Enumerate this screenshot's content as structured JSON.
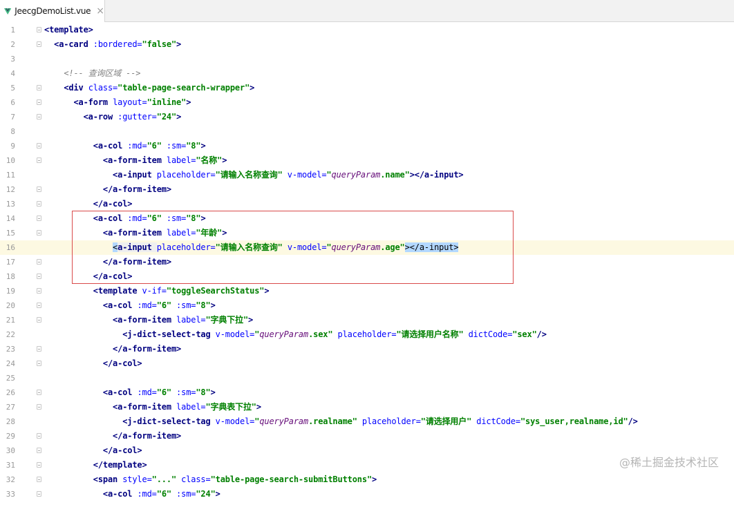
{
  "tab": {
    "filename": "JeecgDemoList.vue",
    "close_icon": "×"
  },
  "watermark": "@稀土掘金技术社区",
  "lines": [
    {
      "n": "1",
      "fold": true,
      "segs": [
        [
          "t",
          "<template>"
        ]
      ]
    },
    {
      "n": "2",
      "fold": true,
      "segs": [
        [
          "p",
          "  "
        ],
        [
          "t",
          "<a-card "
        ],
        [
          "a",
          ":bordered="
        ],
        [
          "v",
          "\"false\""
        ],
        [
          "t",
          ">"
        ]
      ]
    },
    {
      "n": "3",
      "segs": []
    },
    {
      "n": "4",
      "segs": [
        [
          "p",
          "    "
        ],
        [
          "c",
          "<!-- 查询区域 -->"
        ]
      ]
    },
    {
      "n": "5",
      "fold": true,
      "segs": [
        [
          "p",
          "    "
        ],
        [
          "t",
          "<div "
        ],
        [
          "a",
          "class="
        ],
        [
          "v",
          "\"table-page-search-wrapper\""
        ],
        [
          "t",
          ">"
        ]
      ]
    },
    {
      "n": "6",
      "fold": true,
      "segs": [
        [
          "p",
          "      "
        ],
        [
          "t",
          "<a-form "
        ],
        [
          "a",
          "layout="
        ],
        [
          "v",
          "\"inline\""
        ],
        [
          "t",
          ">"
        ]
      ]
    },
    {
      "n": "7",
      "fold": true,
      "segs": [
        [
          "p",
          "        "
        ],
        [
          "t",
          "<a-row "
        ],
        [
          "a",
          ":gutter="
        ],
        [
          "v",
          "\"24\""
        ],
        [
          "t",
          ">"
        ]
      ]
    },
    {
      "n": "8",
      "segs": []
    },
    {
      "n": "9",
      "fold": true,
      "segs": [
        [
          "p",
          "          "
        ],
        [
          "t",
          "<a-col "
        ],
        [
          "a",
          ":md="
        ],
        [
          "v",
          "\"6\""
        ],
        [
          "a",
          " :sm="
        ],
        [
          "v",
          "\"8\""
        ],
        [
          "t",
          ">"
        ]
      ]
    },
    {
      "n": "10",
      "fold": true,
      "segs": [
        [
          "p",
          "            "
        ],
        [
          "t",
          "<a-form-item "
        ],
        [
          "a",
          "label="
        ],
        [
          "v",
          "\"名称\""
        ],
        [
          "t",
          ">"
        ]
      ]
    },
    {
      "n": "11",
      "segs": [
        [
          "p",
          "              "
        ],
        [
          "t",
          "<a-input "
        ],
        [
          "a",
          "placeholder="
        ],
        [
          "v",
          "\"请输入名称查询\""
        ],
        [
          "a",
          " v-model="
        ],
        [
          "v",
          "\""
        ],
        [
          "iv",
          "queryParam"
        ],
        [
          "v",
          ".name\""
        ],
        [
          "t",
          "></a-input>"
        ]
      ]
    },
    {
      "n": "12",
      "fold": true,
      "segs": [
        [
          "p",
          "            "
        ],
        [
          "t",
          "</a-form-item>"
        ]
      ]
    },
    {
      "n": "13",
      "fold": true,
      "segs": [
        [
          "p",
          "          "
        ],
        [
          "t",
          "</a-col>"
        ]
      ]
    },
    {
      "n": "14",
      "fold": true,
      "segs": [
        [
          "p",
          "          "
        ],
        [
          "t",
          "<a-col "
        ],
        [
          "a",
          ":md="
        ],
        [
          "v",
          "\"6\""
        ],
        [
          "a",
          " :sm="
        ],
        [
          "v",
          "\"8\""
        ],
        [
          "t",
          ">"
        ]
      ]
    },
    {
      "n": "15",
      "fold": true,
      "segs": [
        [
          "p",
          "            "
        ],
        [
          "t",
          "<a-form-item "
        ],
        [
          "a",
          "label="
        ],
        [
          "v",
          "\"年龄\""
        ],
        [
          "t",
          ">"
        ]
      ]
    },
    {
      "n": "16",
      "caret": true,
      "segs": [
        [
          "p",
          "              "
        ],
        [
          "hl",
          "<"
        ],
        [
          "tb",
          "a-input "
        ],
        [
          "a",
          "placeholder="
        ],
        [
          "v",
          "\"请输入名称查询\""
        ],
        [
          "a",
          " v-model="
        ],
        [
          "v",
          "\""
        ],
        [
          "iv",
          "queryParam"
        ],
        [
          "v",
          ".age\""
        ],
        [
          "hl",
          ">"
        ],
        [
          "hl",
          "</a-input>"
        ]
      ]
    },
    {
      "n": "17",
      "fold": true,
      "segs": [
        [
          "p",
          "            "
        ],
        [
          "t",
          "</a-form-item>"
        ]
      ]
    },
    {
      "n": "18",
      "fold": true,
      "segs": [
        [
          "p",
          "          "
        ],
        [
          "t",
          "</a-col>"
        ]
      ]
    },
    {
      "n": "19",
      "fold": true,
      "segs": [
        [
          "p",
          "          "
        ],
        [
          "t",
          "<template "
        ],
        [
          "a",
          "v-if="
        ],
        [
          "v",
          "\"toggleSearchStatus\""
        ],
        [
          "t",
          ">"
        ]
      ]
    },
    {
      "n": "20",
      "fold": true,
      "segs": [
        [
          "p",
          "            "
        ],
        [
          "t",
          "<a-col "
        ],
        [
          "a",
          ":md="
        ],
        [
          "v",
          "\"6\""
        ],
        [
          "a",
          " :sm="
        ],
        [
          "v",
          "\"8\""
        ],
        [
          "t",
          ">"
        ]
      ]
    },
    {
      "n": "21",
      "fold": true,
      "segs": [
        [
          "p",
          "              "
        ],
        [
          "t",
          "<a-form-item "
        ],
        [
          "a",
          "label="
        ],
        [
          "v",
          "\"字典下拉\""
        ],
        [
          "t",
          ">"
        ]
      ]
    },
    {
      "n": "22",
      "segs": [
        [
          "p",
          "                "
        ],
        [
          "t",
          "<j-dict-select-tag "
        ],
        [
          "a",
          "v-model="
        ],
        [
          "v",
          "\""
        ],
        [
          "iv",
          "queryParam"
        ],
        [
          "v",
          ".sex\""
        ],
        [
          "a",
          " placeholder="
        ],
        [
          "v",
          "\"请选择用户名称\""
        ],
        [
          "a",
          " dictCode="
        ],
        [
          "v",
          "\"sex\""
        ],
        [
          "t",
          "/>"
        ]
      ]
    },
    {
      "n": "23",
      "fold": true,
      "segs": [
        [
          "p",
          "              "
        ],
        [
          "t",
          "</a-form-item>"
        ]
      ]
    },
    {
      "n": "24",
      "fold": true,
      "segs": [
        [
          "p",
          "            "
        ],
        [
          "t",
          "</a-col>"
        ]
      ]
    },
    {
      "n": "25",
      "segs": []
    },
    {
      "n": "26",
      "fold": true,
      "segs": [
        [
          "p",
          "            "
        ],
        [
          "t",
          "<a-col "
        ],
        [
          "a",
          ":md="
        ],
        [
          "v",
          "\"6\""
        ],
        [
          "a",
          " :sm="
        ],
        [
          "v",
          "\"8\""
        ],
        [
          "t",
          ">"
        ]
      ]
    },
    {
      "n": "27",
      "fold": true,
      "segs": [
        [
          "p",
          "              "
        ],
        [
          "t",
          "<a-form-item "
        ],
        [
          "a",
          "label="
        ],
        [
          "v",
          "\"字典表下拉\""
        ],
        [
          "t",
          ">"
        ]
      ]
    },
    {
      "n": "28",
      "segs": [
        [
          "p",
          "                "
        ],
        [
          "t",
          "<j-dict-select-tag "
        ],
        [
          "a",
          "v-model="
        ],
        [
          "v",
          "\""
        ],
        [
          "iv",
          "queryParam"
        ],
        [
          "v",
          ".realname\""
        ],
        [
          "a",
          " placeholder="
        ],
        [
          "v",
          "\"请选择用户\""
        ],
        [
          "a",
          " dictCode="
        ],
        [
          "v",
          "\"sys_user,realname,id\""
        ],
        [
          "t",
          "/>"
        ]
      ]
    },
    {
      "n": "29",
      "fold": true,
      "segs": [
        [
          "p",
          "              "
        ],
        [
          "t",
          "</a-form-item>"
        ]
      ]
    },
    {
      "n": "30",
      "fold": true,
      "segs": [
        [
          "p",
          "            "
        ],
        [
          "t",
          "</a-col>"
        ]
      ]
    },
    {
      "n": "31",
      "fold": true,
      "segs": [
        [
          "p",
          "          "
        ],
        [
          "t",
          "</template>"
        ]
      ]
    },
    {
      "n": "32",
      "fold": true,
      "segs": [
        [
          "p",
          "          "
        ],
        [
          "t",
          "<span "
        ],
        [
          "a",
          "style="
        ],
        [
          "v",
          "\"...\""
        ],
        [
          "a",
          " class="
        ],
        [
          "v",
          "\"table-page-search-submitButtons\""
        ],
        [
          "t",
          ">"
        ]
      ]
    },
    {
      "n": "33",
      "fold": true,
      "segs": [
        [
          "p",
          "            "
        ],
        [
          "t",
          "<a-col "
        ],
        [
          "a",
          ":md="
        ],
        [
          "v",
          "\"6\""
        ],
        [
          "a",
          " :sm="
        ],
        [
          "v",
          "\"24\""
        ],
        [
          "t",
          ">"
        ]
      ]
    }
  ]
}
